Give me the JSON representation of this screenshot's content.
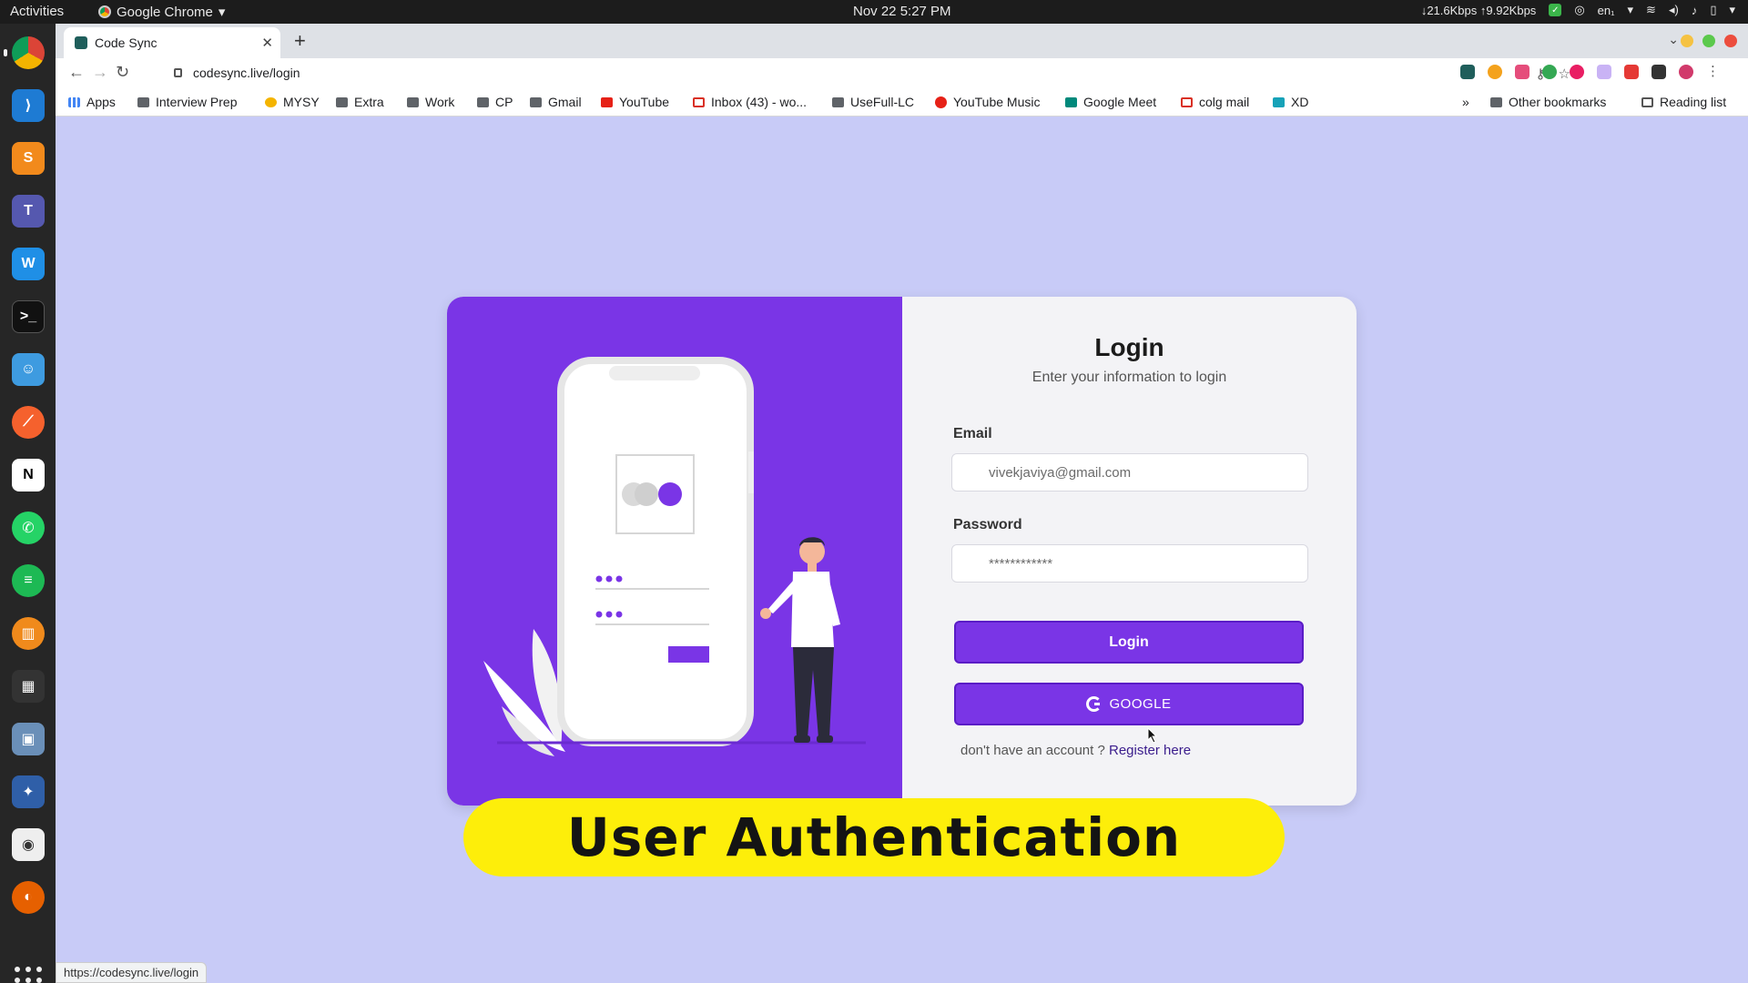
{
  "system_bar": {
    "activities": "Activities",
    "app_name": "Google Chrome",
    "clock": "Nov 22  5:27 PM",
    "net_speed": "↓21.6Kbps ↑9.92Kbps",
    "lang": "en₁"
  },
  "browser": {
    "tab_title": "Code Sync",
    "url": "codesync.live/login",
    "status_url": "https://codesync.live/login",
    "bookmarks": [
      "Apps",
      "Interview Prep",
      "MYSY",
      "Extra",
      "Work",
      "CP",
      "Gmail",
      "YouTube",
      "Inbox (43) - wo...",
      "UseFull-LC",
      "YouTube Music",
      "Google Meet",
      "colg mail",
      "XD"
    ],
    "other_bookmarks": "Other bookmarks",
    "reading_list": "Reading list",
    "overflow": "»"
  },
  "login": {
    "title": "Login",
    "subtitle": "Enter your information to login",
    "email_label": "Email",
    "email_value": "vivekjaviya@gmail.com",
    "password_label": "Password",
    "password_value": "************",
    "login_button": "Login",
    "google_button": "GOOGLE",
    "register_prompt": "don't have an account ?",
    "register_link": "Register here"
  },
  "banner": {
    "text": "User Authentication"
  },
  "colors": {
    "purple": "#7a35e6",
    "page_bg": "#c8cbf7",
    "banner_yellow": "#fdee0a"
  }
}
